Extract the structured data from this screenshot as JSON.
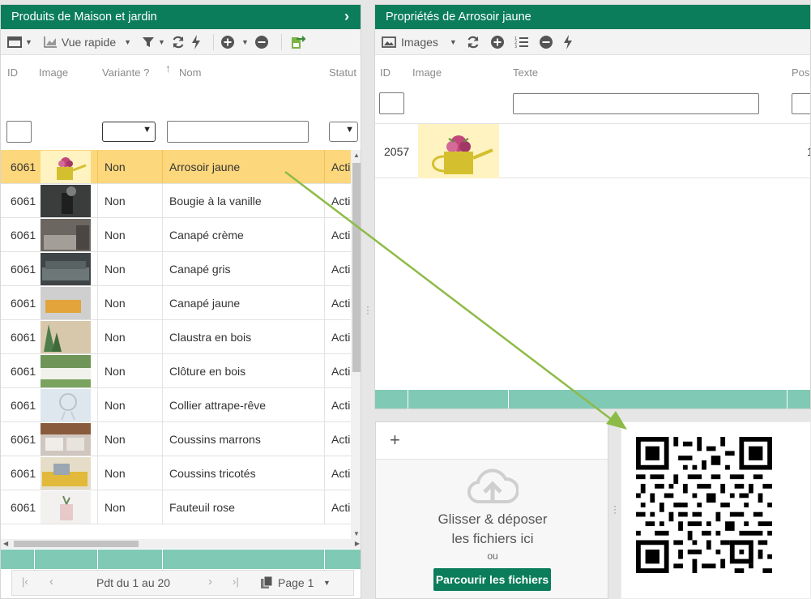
{
  "left_panel": {
    "title": "Produits de Maison et jardin",
    "toolbar": {
      "quick_view": "Vue rapide"
    },
    "columns": {
      "id": "ID",
      "image": "Image",
      "variant": "Variante ?",
      "name": "Nom",
      "status": "Statut"
    },
    "rows": [
      {
        "id": "6061",
        "variant": "Non",
        "name": "Arrosoir jaune",
        "status": "Acti"
      },
      {
        "id": "6061",
        "variant": "Non",
        "name": "Bougie à la vanille",
        "status": "Acti"
      },
      {
        "id": "6061",
        "variant": "Non",
        "name": "Canapé crème",
        "status": "Acti"
      },
      {
        "id": "6061",
        "variant": "Non",
        "name": "Canapé gris",
        "status": "Acti"
      },
      {
        "id": "6061",
        "variant": "Non",
        "name": "Canapé jaune",
        "status": "Acti"
      },
      {
        "id": "6061",
        "variant": "Non",
        "name": "Claustra en bois",
        "status": "Acti"
      },
      {
        "id": "6061",
        "variant": "Non",
        "name": "Clôture en bois",
        "status": "Acti"
      },
      {
        "id": "6061",
        "variant": "Non",
        "name": "Collier attrape-rêve",
        "status": "Acti"
      },
      {
        "id": "6061",
        "variant": "Non",
        "name": "Coussins marrons",
        "status": "Acti"
      },
      {
        "id": "6061",
        "variant": "Non",
        "name": "Coussins tricotés",
        "status": "Acti"
      },
      {
        "id": "6061",
        "variant": "Non",
        "name": "Fauteuil rose",
        "status": "Acti"
      }
    ],
    "pager": {
      "range": "Pdt du 1 au 20",
      "page": "Page 1"
    }
  },
  "right_panel": {
    "title": "Propriétés de Arrosoir jaune",
    "toolbar": {
      "images": "Images"
    },
    "columns": {
      "id": "ID",
      "image": "Image",
      "text": "Texte",
      "pos": "Pos."
    },
    "rows": [
      {
        "id": "2057",
        "pos": "1"
      }
    ]
  },
  "upload": {
    "add": "+",
    "title_line1": "Glisser & déposer",
    "title_line2": "les fichiers ici",
    "or": "ou",
    "browse": "Parcourir les fichiers"
  },
  "colors": {
    "header": "#0b7d5a",
    "selected_row": "#fcd77c",
    "footer": "#80c9b4",
    "arrow": "#8dbb47"
  }
}
